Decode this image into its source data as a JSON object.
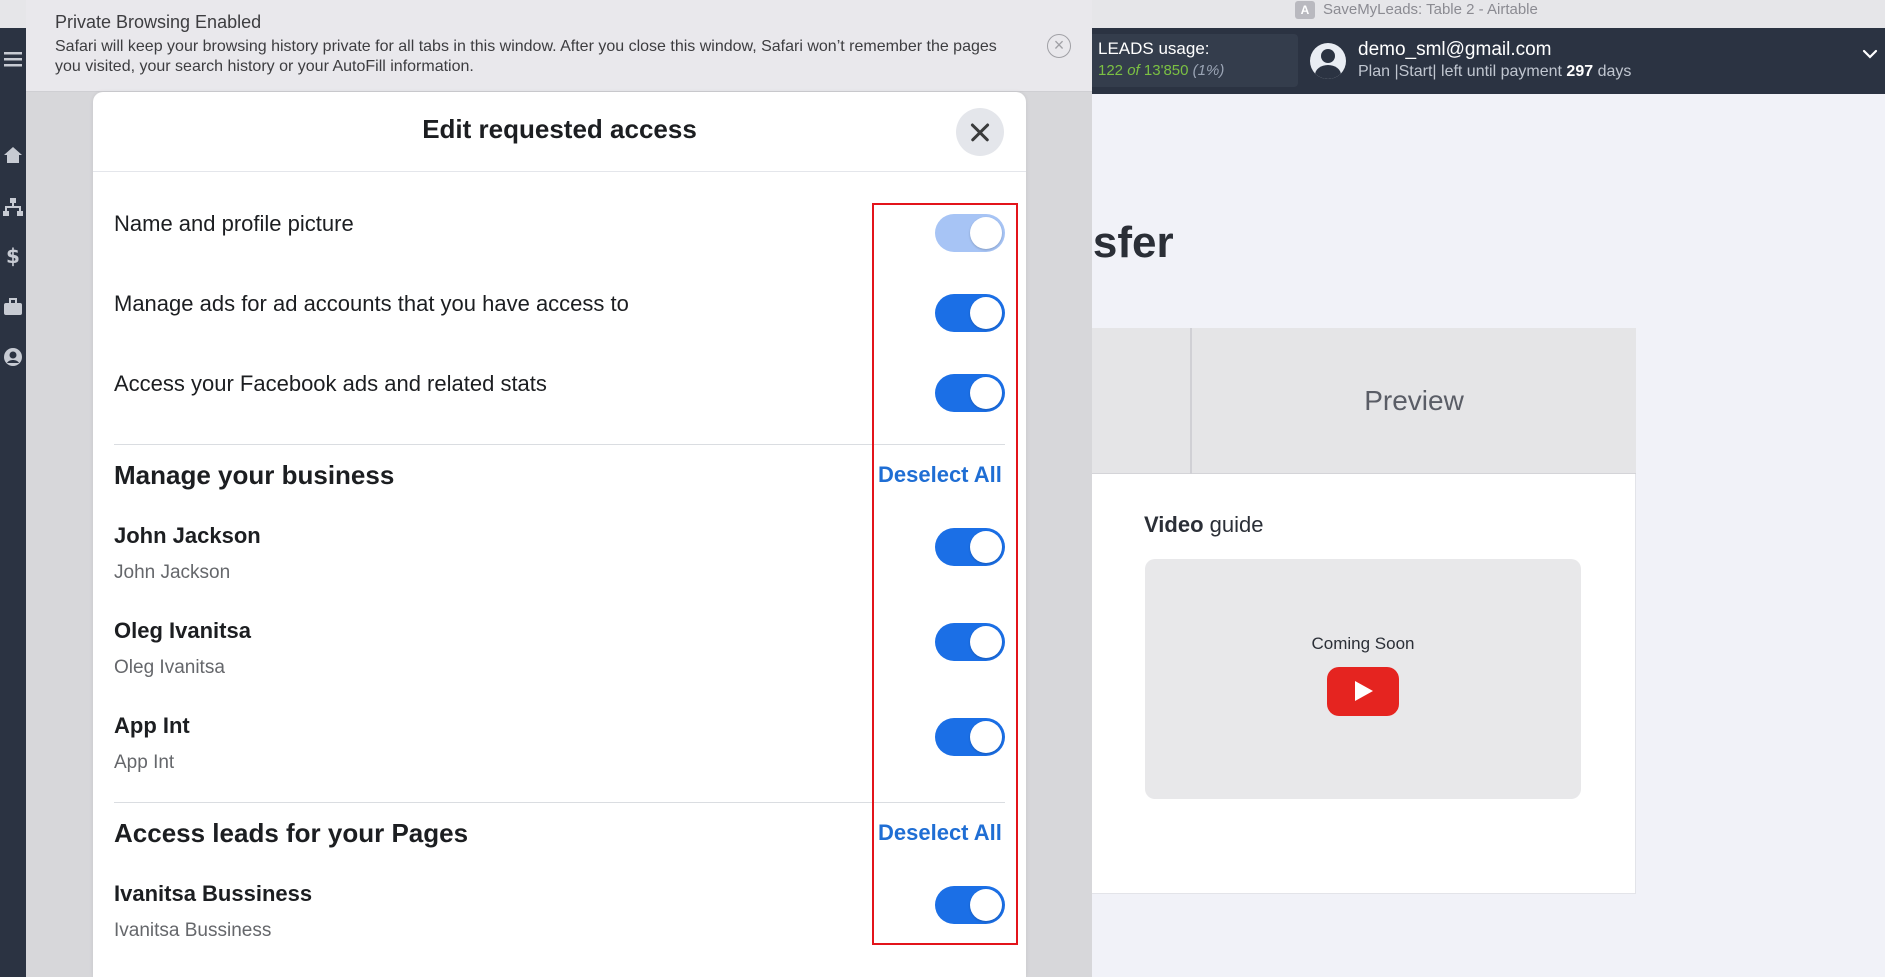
{
  "app": {
    "window_title": "SaveMyLeads: Table 2 - Airtable",
    "app_badge": "A",
    "leads": {
      "title": "LEADS usage:",
      "used": "122",
      "of": "of",
      "total": "13'850",
      "percent": "(1%)"
    },
    "user": {
      "email": "demo_sml@gmail.com",
      "plan_prefix": "Plan |Start| left until payment",
      "days_number": "297",
      "days_suffix": "days"
    },
    "page_heading": "nsfer",
    "tab_preview": "Preview",
    "video": {
      "label_bold": "Video",
      "label_rest": "guide",
      "coming_soon": "Coming Soon"
    },
    "colors": {
      "header_bg": "#2b3342",
      "leads_green": "#7bc043",
      "youtube_red": "#e52420"
    }
  },
  "sidebar": {
    "icons": [
      "menu-icon",
      "home-icon",
      "sitemap-icon",
      "dollar-icon",
      "briefcase-icon",
      "user-circle-icon"
    ]
  },
  "safari": {
    "banner_title": "Private Browsing Enabled",
    "banner_text": "Safari will keep your browsing history private for all tabs in this window. After you close this window, Safari won’t remember the pages you visited, your search history or your AutoFill information."
  },
  "dialog": {
    "title": "Edit requested access",
    "permissions": [
      {
        "label": "Name and profile picture",
        "enabled": true,
        "locked": true
      },
      {
        "label": "Manage ads for ad accounts that you have access to",
        "enabled": true
      },
      {
        "label": "Access your Facebook ads and related stats",
        "enabled": true
      }
    ],
    "business": {
      "title": "Manage your business",
      "deselect_label": "Deselect All",
      "items": [
        {
          "name": "John Jackson",
          "sub": "John Jackson",
          "enabled": true
        },
        {
          "name": "Oleg Ivanitsa",
          "sub": "Oleg Ivanitsa",
          "enabled": true
        },
        {
          "name": "App Int",
          "sub": "App Int",
          "enabled": true
        }
      ]
    },
    "pages": {
      "title": "Access leads for your Pages",
      "deselect_label": "Deselect All",
      "items": [
        {
          "name": "Ivanitsa Bussiness",
          "sub": "Ivanitsa Bussiness",
          "enabled": true
        }
      ]
    },
    "colors": {
      "toggle_on": "#1b6fe6",
      "toggle_locked": "#a7c4f5",
      "link_blue": "#1f6ed4",
      "highlight_frame": "#e3141b"
    }
  }
}
